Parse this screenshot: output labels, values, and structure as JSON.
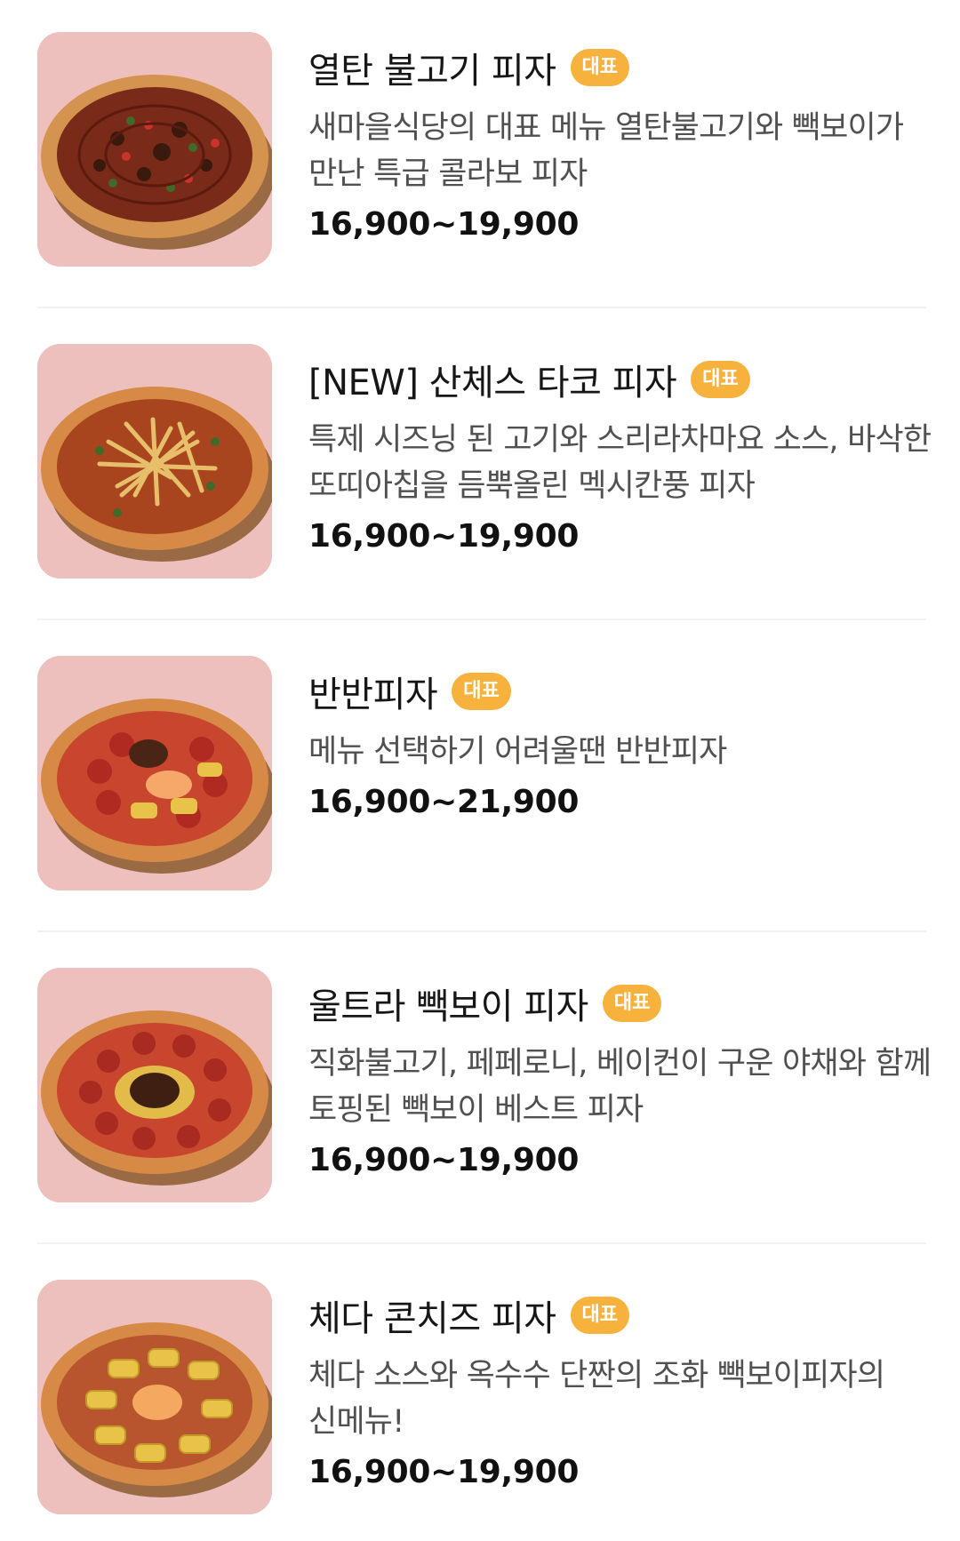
{
  "badge_color": "#f6b23c",
  "thumb_bg": "#edc0bd",
  "menu_items": [
    {
      "title": "열탄 불고기 피자",
      "badge": "대표",
      "description": "새마을식당의 대표 메뉴 열탄불고기와 빽보이가 만난 특급 콜라보 피자",
      "price": "16,900~19,900",
      "image": "pizza-bulgogi-image"
    },
    {
      "title": "[NEW] 산체스 타코 피자",
      "badge": "대표",
      "description": "특제 시즈닝 된 고기와 스리라차마요 소스, 바삭한 또띠아칩을 듬뿍올린 멕시칸풍 피자",
      "price": "16,900~19,900",
      "image": "pizza-taco-image"
    },
    {
      "title": "반반피자",
      "badge": "대표",
      "description": "메뉴 선택하기 어려울땐 반반피자",
      "price": "16,900~21,900",
      "image": "pizza-half-half-image"
    },
    {
      "title": "울트라 빽보이 피자",
      "badge": "대표",
      "description": "직화불고기, 페페로니, 베이컨이 구운 야채와 함께 토핑된 빽보이 베스트 피자",
      "price": "16,900~19,900",
      "image": "pizza-ultra-image"
    },
    {
      "title": "체다 콘치즈 피자",
      "badge": "대표",
      "description": "체다 소스와 옥수수 단짠의 조화 빽보이피자의 신메뉴!",
      "price": "16,900~19,900",
      "image": "pizza-cheddar-corn-image"
    }
  ]
}
